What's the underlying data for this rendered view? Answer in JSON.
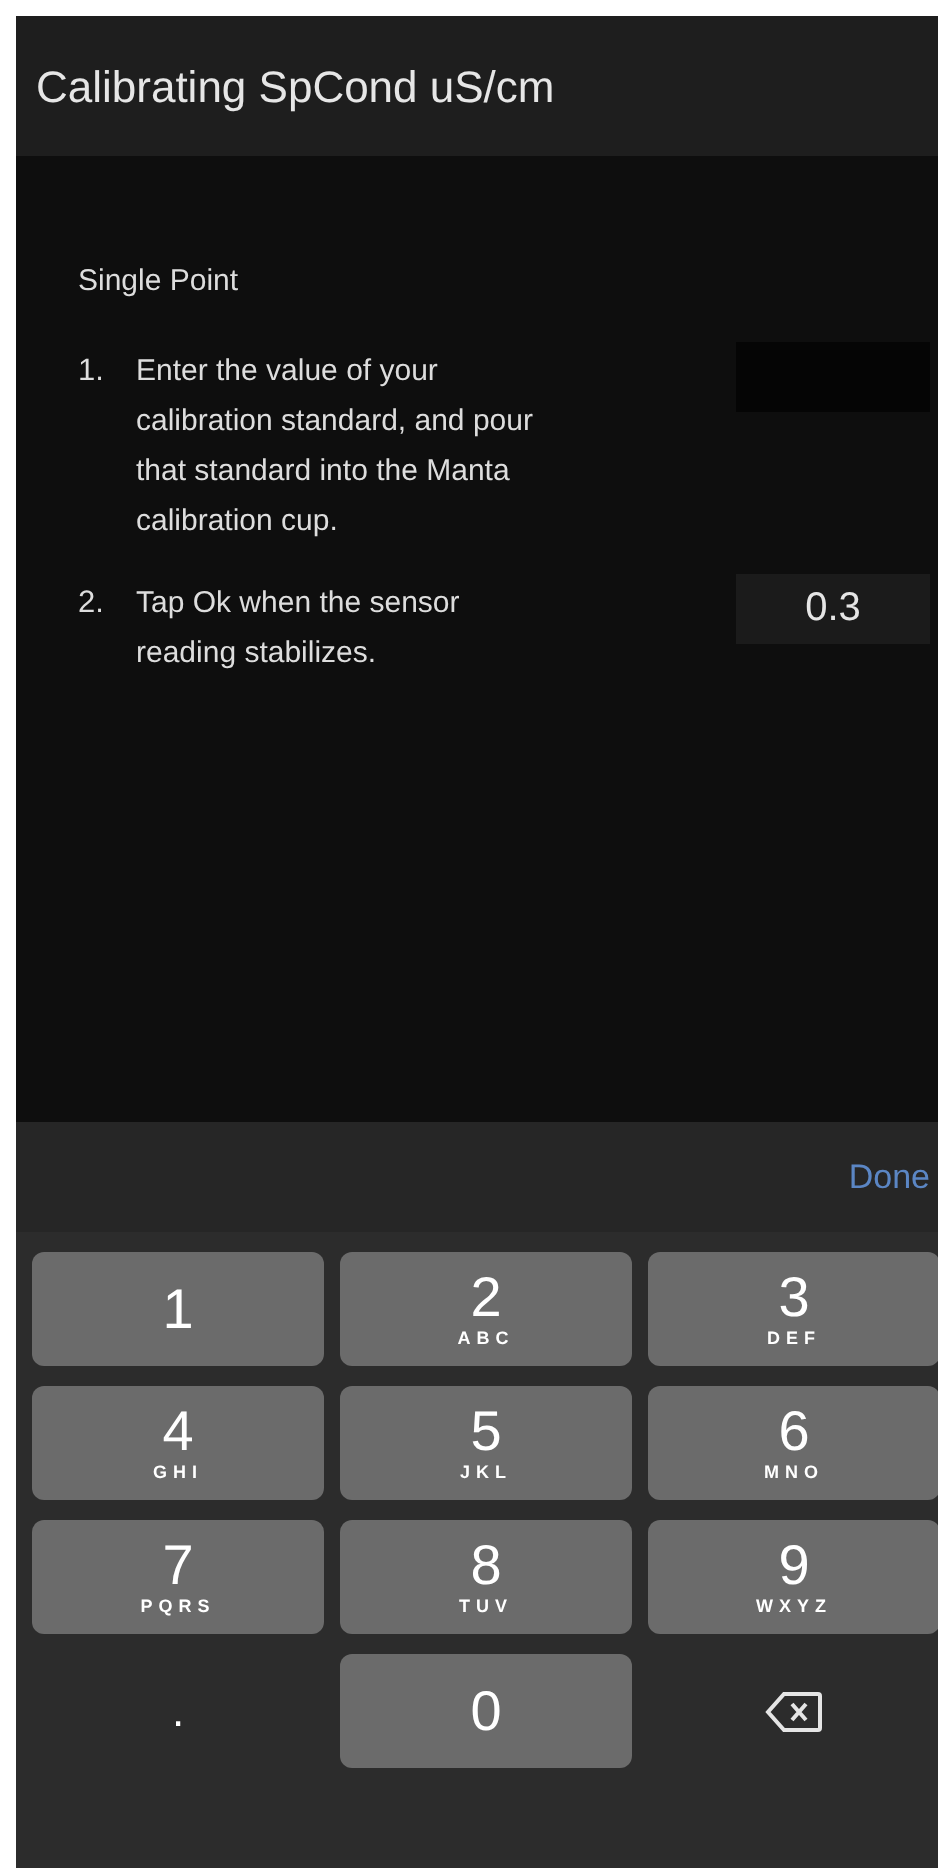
{
  "header": {
    "title": "Calibrating SpCond uS/cm"
  },
  "section": {
    "title": "Single Point"
  },
  "steps": [
    {
      "number": "1.",
      "text": "Enter the value of your calibration standard, and pour that standard into the Manta calibration cup.",
      "field": {
        "kind": "input"
      }
    },
    {
      "number": "2.",
      "text": "Tap Ok when the sensor reading stabilizes.",
      "field": {
        "kind": "reading",
        "value": "0.3"
      }
    }
  ],
  "keyboard": {
    "done": "Done",
    "keys": [
      {
        "kind": "digit",
        "label": "1"
      },
      {
        "kind": "digit",
        "label": "2",
        "letters": "ABC"
      },
      {
        "kind": "digit",
        "label": "3",
        "letters": "DEF"
      },
      {
        "kind": "digit",
        "label": "4",
        "letters": "GHI"
      },
      {
        "kind": "digit",
        "label": "5",
        "letters": "JKL"
      },
      {
        "kind": "digit",
        "label": "6",
        "letters": "MNO"
      },
      {
        "kind": "digit",
        "label": "7",
        "letters": "PQRS"
      },
      {
        "kind": "digit",
        "label": "8",
        "letters": "TUV"
      },
      {
        "kind": "digit",
        "label": "9",
        "letters": "WXYZ"
      },
      {
        "kind": "plain",
        "label": "."
      },
      {
        "kind": "digit",
        "label": "0"
      },
      {
        "kind": "backspace"
      }
    ]
  }
}
